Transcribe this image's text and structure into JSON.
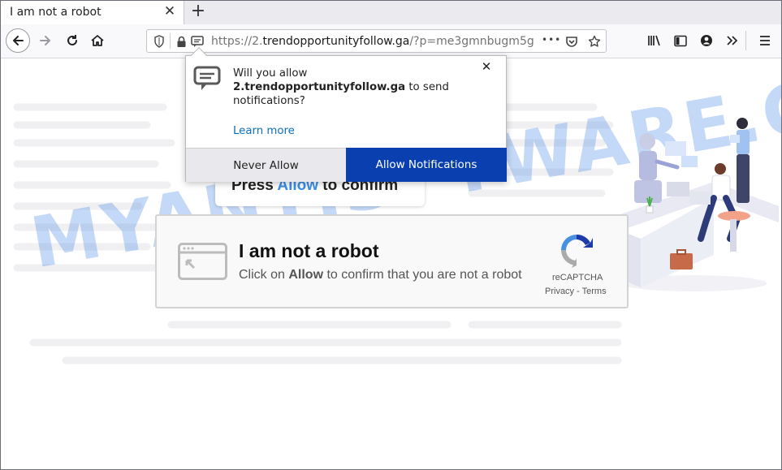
{
  "tab": {
    "title": "I am not a robot",
    "close_glyph": "✕"
  },
  "newtab": {
    "glyph": "+"
  },
  "url": {
    "prefix": "https://2.",
    "domain": "trendopportunityfollow.ga",
    "path": "/?p=me3gmnbugm5g"
  },
  "urlbar": {
    "more_glyph": "•••"
  },
  "popup": {
    "message_pre": "Will you allow",
    "message_domain": "2.trendopportunityfollow.ga",
    "message_post": " to send notifications?",
    "learn_more": "Learn more",
    "never_allow": "Never Allow",
    "allow": "Allow Notifications",
    "close_glyph": "✕"
  },
  "press": {
    "pre": "Press ",
    "highlight": "Allow",
    "post": " to confirm"
  },
  "captcha": {
    "title": "I am not a robot",
    "sub_pre": "Click on ",
    "sub_bold": "Allow",
    "sub_post": " to confirm that you are not a robot",
    "recaptcha_label": "reCAPTCHA",
    "links": "Privacy - Terms"
  },
  "watermark": "MYANTISPYWARE.COM",
  "colors": {
    "allow_button": "#0a3fb0",
    "link": "#0a6fc2",
    "highlight": "#3b8ee5",
    "watermark": "#4687e6"
  }
}
